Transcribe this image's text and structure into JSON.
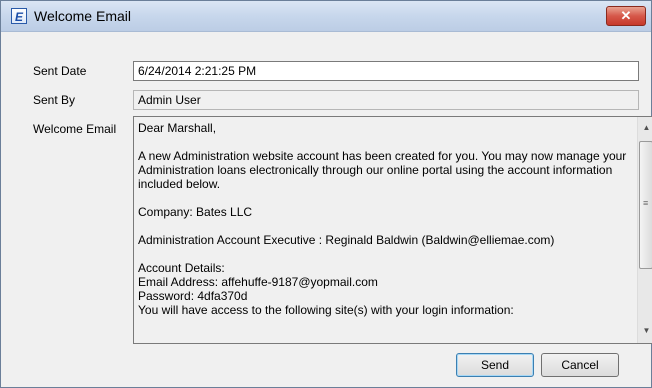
{
  "window": {
    "title": "Welcome Email",
    "app_icon_glyph": "E",
    "close_glyph": "✕"
  },
  "form": {
    "sent_date_label": "Sent Date",
    "sent_date_value": "6/24/2014 2:21:25 PM",
    "sent_by_label": "Sent By",
    "sent_by_value": "Admin User",
    "welcome_email_label": "Welcome Email"
  },
  "email_body": {
    "greeting": "Dear Marshall,",
    "intro": "A new Administration website account has been created for you. You may now manage your Administration loans electronically through our online portal using the account information included below.",
    "company": "Company: Bates LLC",
    "executive": "Administration Account Executive : Reginald Baldwin (Baldwin@elliemae.com)",
    "details_heading": "Account Details:",
    "email_address": "Email Address: affehuffe-9187@yopmail.com",
    "password": "Password: 4dfa370d",
    "access_line": "You will have access to the following site(s) with your login information:"
  },
  "buttons": {
    "send": "Send",
    "cancel": "Cancel"
  },
  "icons": {
    "scroll_up": "▲",
    "scroll_down": "▼",
    "grip": "≡"
  },
  "colors": {
    "titlebar": "#c7d7ec",
    "close_button": "#d6584a",
    "dialog_bg": "#f0f0f0"
  }
}
